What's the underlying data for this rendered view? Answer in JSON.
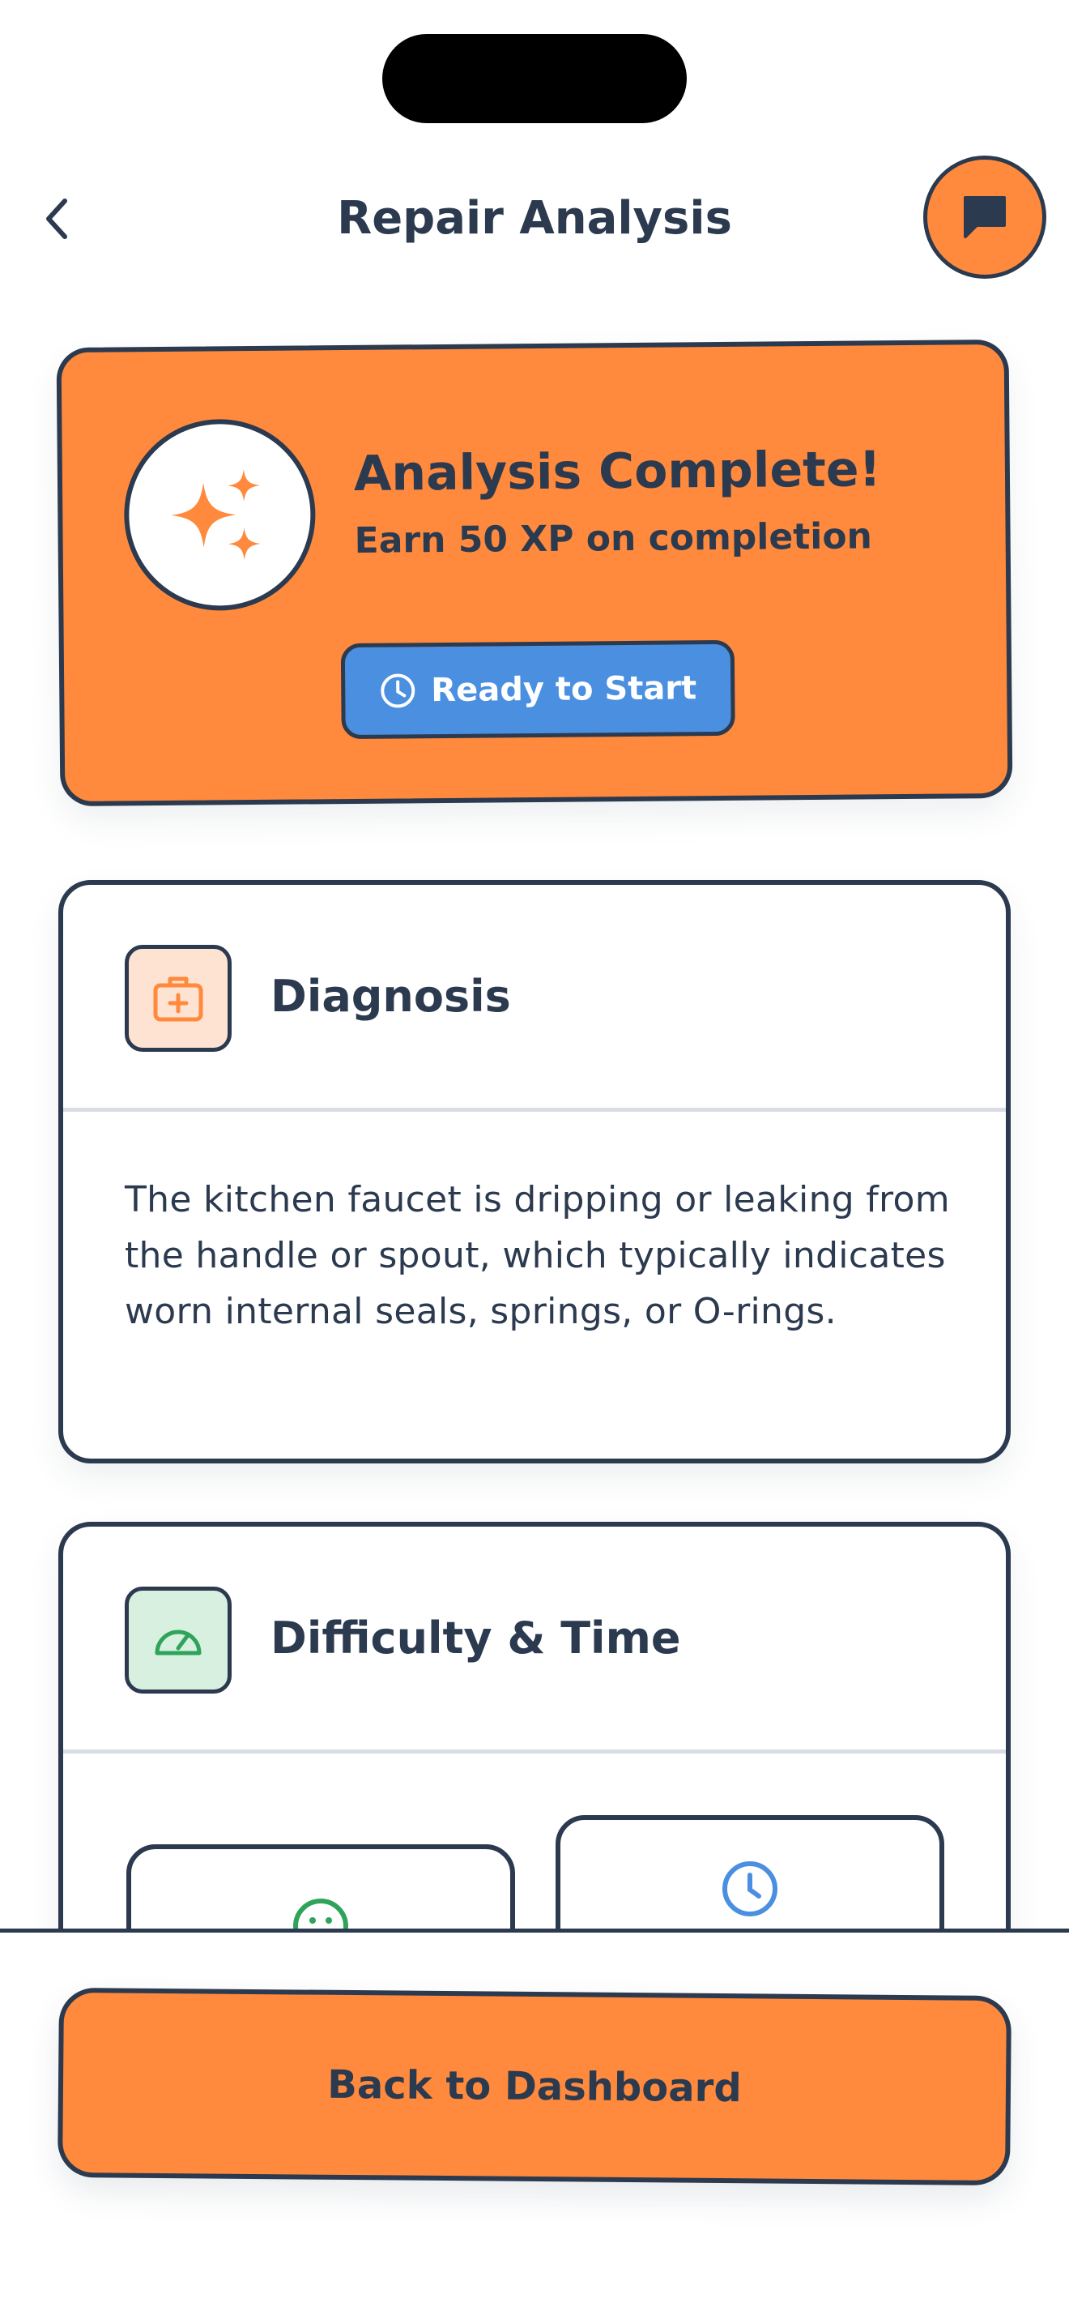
{
  "header": {
    "title": "Repair Analysis",
    "back_icon": "chevron-left-icon",
    "chat_icon": "chat-bubble-icon"
  },
  "hero": {
    "icon": "sparkles-icon",
    "title": "Analysis Complete!",
    "subtitle": "Earn 50 XP on completion",
    "status_button": "Ready to Start",
    "status_icon": "clock-icon"
  },
  "diagnosis": {
    "title": "Diagnosis",
    "icon": "medical-kit-icon",
    "text": "The kitchen faucet is dripping or leaking from the handle or spout, which typically indicates worn internal seals, springs, or O-rings."
  },
  "difficulty": {
    "title": "Difficulty & Time",
    "icon": "speedometer-icon",
    "cards": [
      {
        "icon": "smiley-icon"
      },
      {
        "icon": "clock-icon"
      }
    ]
  },
  "footer": {
    "button_label": "Back to Dashboard"
  },
  "colors": {
    "accent_orange": "#ff8a3d",
    "ink": "#2c3a4f",
    "blue": "#4a8fe0",
    "green": "#2fa35a"
  }
}
